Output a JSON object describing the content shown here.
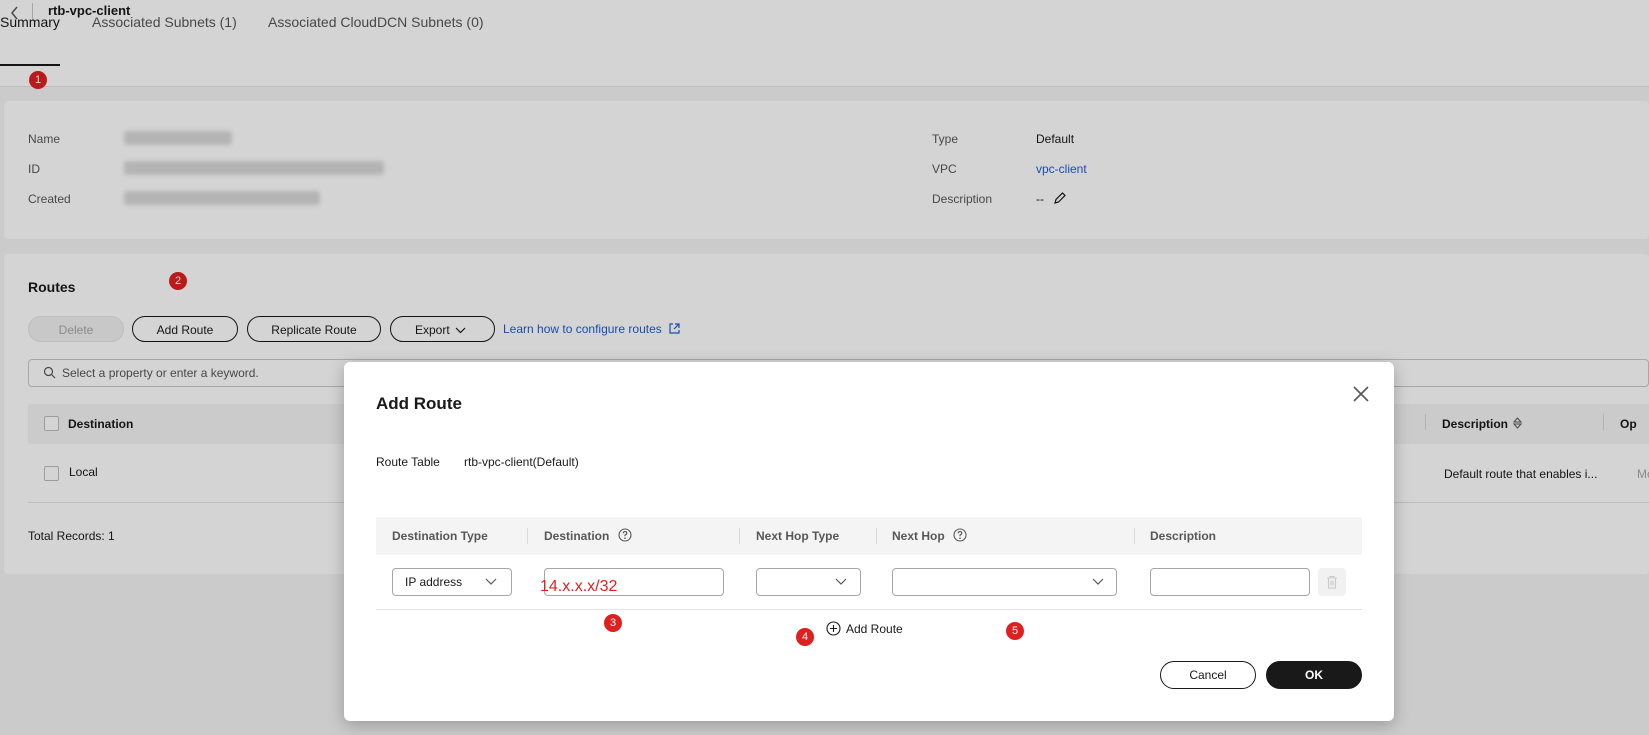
{
  "header": {
    "title": "rtb-vpc-client"
  },
  "tabs": [
    {
      "label": "Summary"
    },
    {
      "label": "Associated Subnets (1)"
    },
    {
      "label": "Associated CloudDCN Subnets (0)"
    }
  ],
  "summary": {
    "name_label": "Name",
    "id_label": "ID",
    "created_label": "Created",
    "type_label": "Type",
    "type_value": "Default",
    "vpc_label": "VPC",
    "vpc_value": "vpc-client",
    "description_label": "Description",
    "description_value": "--"
  },
  "routes": {
    "title": "Routes",
    "delete_label": "Delete",
    "add_route_label": "Add Route",
    "replicate_label": "Replicate Route",
    "export_label": "Export",
    "learn_link": "Learn how to configure routes",
    "search_placeholder": "Select a property or enter a keyword.",
    "columns": {
      "destination": "Destination",
      "description": "Description",
      "operation": "Op"
    },
    "rows": [
      {
        "destination": "Local",
        "description": "Default route that enables i...",
        "operation": "Mo"
      }
    ],
    "total": "Total Records: 1"
  },
  "modal": {
    "title": "Add Route",
    "route_table_label": "Route Table",
    "route_table_value": "rtb-vpc-client(Default)",
    "columns": {
      "destination_type": "Destination Type",
      "destination": "Destination",
      "next_hop_type": "Next Hop Type",
      "next_hop": "Next Hop",
      "description": "Description"
    },
    "row": {
      "destination_type": "IP address",
      "destination": "14.x.x.x/32",
      "next_hop_type": "",
      "next_hop": "",
      "description": ""
    },
    "add_route_label": "Add Route",
    "cancel_label": "Cancel",
    "ok_label": "OK"
  },
  "markers": [
    "1",
    "2",
    "3",
    "4",
    "5"
  ],
  "colors": {
    "accent_link": "#1a5fd1",
    "marker": "#e02020",
    "primary_button": "#191919"
  }
}
